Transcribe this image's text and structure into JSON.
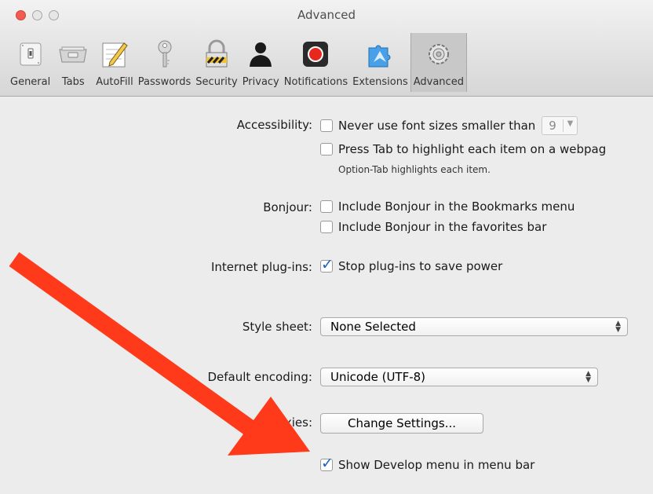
{
  "window": {
    "title": "Advanced"
  },
  "toolbar": {
    "items": [
      {
        "label": "General",
        "icon": "switch-icon"
      },
      {
        "label": "Tabs",
        "icon": "tabs-icon"
      },
      {
        "label": "AutoFill",
        "icon": "pencil-form-icon"
      },
      {
        "label": "Passwords",
        "icon": "key-icon"
      },
      {
        "label": "Security",
        "icon": "padlock-icon"
      },
      {
        "label": "Privacy",
        "icon": "person-silhouette-icon"
      },
      {
        "label": "Notifications",
        "icon": "notification-record-icon"
      },
      {
        "label": "Extensions",
        "icon": "puzzle-compass-icon"
      },
      {
        "label": "Advanced",
        "icon": "gears-icon",
        "selected": true
      }
    ]
  },
  "settings": {
    "accessibility": {
      "label": "Accessibility:",
      "min_font_label": "Never use font sizes smaller than",
      "min_font_value": "9",
      "min_font_checked": false,
      "tab_highlight_label": "Press Tab to highlight each item on a webpag",
      "tab_highlight_checked": false,
      "note": "Option-Tab highlights each item."
    },
    "bonjour": {
      "label": "Bonjour:",
      "bookmarks_label": "Include Bonjour in the Bookmarks menu",
      "bookmarks_checked": false,
      "favorites_label": "Include Bonjour in the favorites bar",
      "favorites_checked": false
    },
    "plugins": {
      "label": "Internet plug-ins:",
      "stop_label": "Stop plug-ins to save power",
      "stop_checked": true
    },
    "style_sheet": {
      "label": "Style sheet:",
      "value": "None Selected"
    },
    "encoding": {
      "label": "Default encoding:",
      "value": "Unicode (UTF-8)"
    },
    "proxies": {
      "label": "Proxies:",
      "button": "Change Settings..."
    },
    "develop": {
      "label": "Show Develop menu in menu bar",
      "checked": true
    }
  },
  "annotation": {
    "arrow_color": "#ff3a1a"
  },
  "colors": {
    "checkmark": "#1a62c9",
    "close_button": "#f25a52"
  }
}
